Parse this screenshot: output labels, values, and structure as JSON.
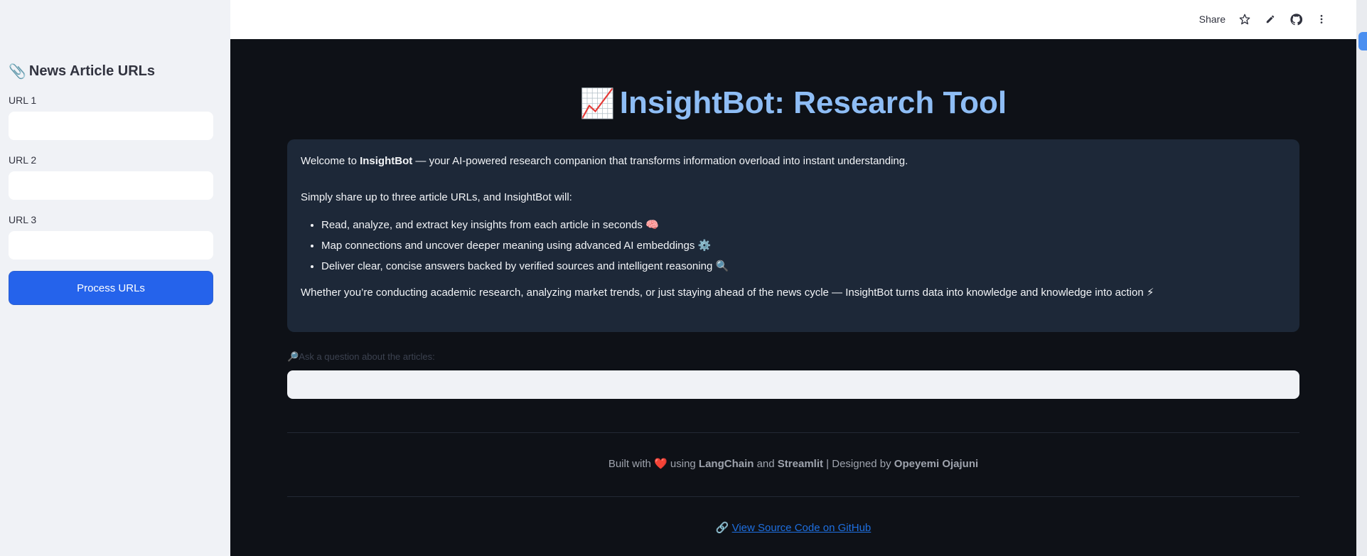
{
  "header": {
    "share_label": "Share",
    "icons": [
      "star-icon",
      "pencil-icon",
      "github-icon",
      "more-vertical-icon"
    ]
  },
  "sidebar": {
    "heading_icon": "📎",
    "heading": "News Article URLs",
    "fields": [
      {
        "label": "URL 1",
        "value": ""
      },
      {
        "label": "URL 2",
        "value": ""
      },
      {
        "label": "URL 3",
        "value": ""
      }
    ],
    "process_button": "Process URLs"
  },
  "main": {
    "title_icon": "📈",
    "title": "InsightBot: Research Tool",
    "card": {
      "welcome_prefix": "Welcome to ",
      "welcome_bold": "InsightBot",
      "welcome_suffix": " — your AI-powered research companion that transforms information overload into instant understanding.",
      "intro": "Simply share up to three article URLs, and InsightBot will:",
      "bullets": [
        {
          "text": "Read, analyze, and extract key insights from each article in seconds",
          "emoji": "🧠"
        },
        {
          "text": "Map connections and uncover deeper meaning using advanced AI embeddings",
          "emoji": "⚙️"
        },
        {
          "text": "Deliver clear, concise answers backed by verified sources and intelligent reasoning",
          "emoji": "🔍"
        }
      ],
      "closing": "Whether you’re conducting academic research, analyzing market trends, or just staying ahead of the news cycle — InsightBot turns data into knowledge and knowledge into action",
      "closing_emoji": "⚡"
    },
    "question": {
      "label_icon": "🔎",
      "label": "Ask a question about the articles:",
      "value": ""
    }
  },
  "footer": {
    "built_with": "Built with",
    "heart": "❤️",
    "using": "using",
    "langchain": "LangChain",
    "and": "and",
    "streamlit": "Streamlit",
    "designed_by": "| Designed by",
    "author": "Opeyemi Ojajuni",
    "link_icon": "🔗",
    "link_text": "View Source Code on GitHub"
  },
  "colors": {
    "sidebar_bg": "#f0f2f6",
    "main_bg": "#0e1117",
    "card_bg": "#1d2838",
    "title": "#8ebdf5",
    "button": "#2563eb",
    "link": "#1e6fe0"
  }
}
